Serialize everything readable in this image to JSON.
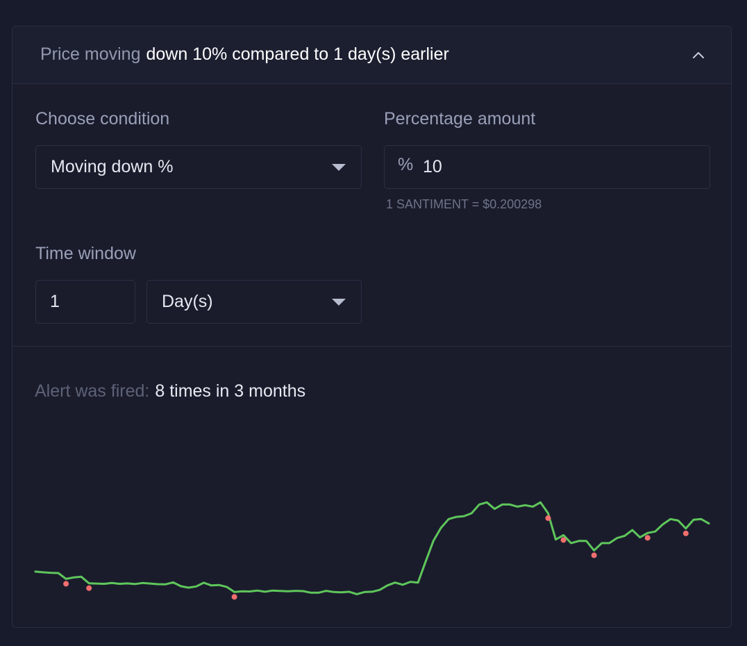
{
  "header": {
    "label": "Price moving",
    "description": "down 10% compared to 1 day(s) earlier"
  },
  "condition": {
    "label": "Choose condition",
    "value": "Moving down %"
  },
  "percentage": {
    "label": "Percentage amount",
    "prefix": "%",
    "value": "10",
    "hint": "1 SANTIMENT = $0.200298"
  },
  "time_window": {
    "label": "Time window",
    "amount": "1",
    "unit": "Day(s)"
  },
  "fired": {
    "label": "Alert was fired:",
    "value": "8 times in 3 months"
  },
  "colors": {
    "line": "#5fc65b",
    "marker": "#f06e6e",
    "background": "#1a1c2c"
  },
  "chart_data": {
    "type": "line",
    "title": "",
    "xlabel": "",
    "ylabel": "",
    "grid": false,
    "legend": "none",
    "ylim": [
      0,
      1
    ],
    "series": [
      {
        "values": [
          0.31,
          0.305,
          0.302,
          0.3,
          0.26,
          0.27,
          0.275,
          0.23,
          0.228,
          0.226,
          0.232,
          0.226,
          0.229,
          0.225,
          0.232,
          0.228,
          0.224,
          0.223,
          0.236,
          0.21,
          0.2,
          0.208,
          0.234,
          0.215,
          0.218,
          0.205,
          0.17,
          0.175,
          0.174,
          0.18,
          0.172,
          0.18,
          0.177,
          0.175,
          0.178,
          0.176,
          0.165,
          0.165,
          0.178,
          0.17,
          0.168,
          0.172,
          0.155,
          0.17,
          0.172,
          0.185,
          0.215,
          0.235,
          0.22,
          0.24,
          0.235,
          0.38,
          0.52,
          0.61,
          0.67,
          0.685,
          0.69,
          0.71,
          0.77,
          0.785,
          0.74,
          0.77,
          0.77,
          0.755,
          0.765,
          0.755,
          0.785,
          0.71,
          0.53,
          0.56,
          0.505,
          0.52,
          0.52,
          0.455,
          0.505,
          0.505,
          0.54,
          0.555,
          0.595,
          0.545,
          0.575,
          0.585,
          0.635,
          0.67,
          0.66,
          0.605,
          0.665,
          0.67,
          0.64
        ],
        "fired": [
          4,
          7,
          26,
          67,
          69,
          73,
          80,
          85
        ]
      }
    ]
  }
}
